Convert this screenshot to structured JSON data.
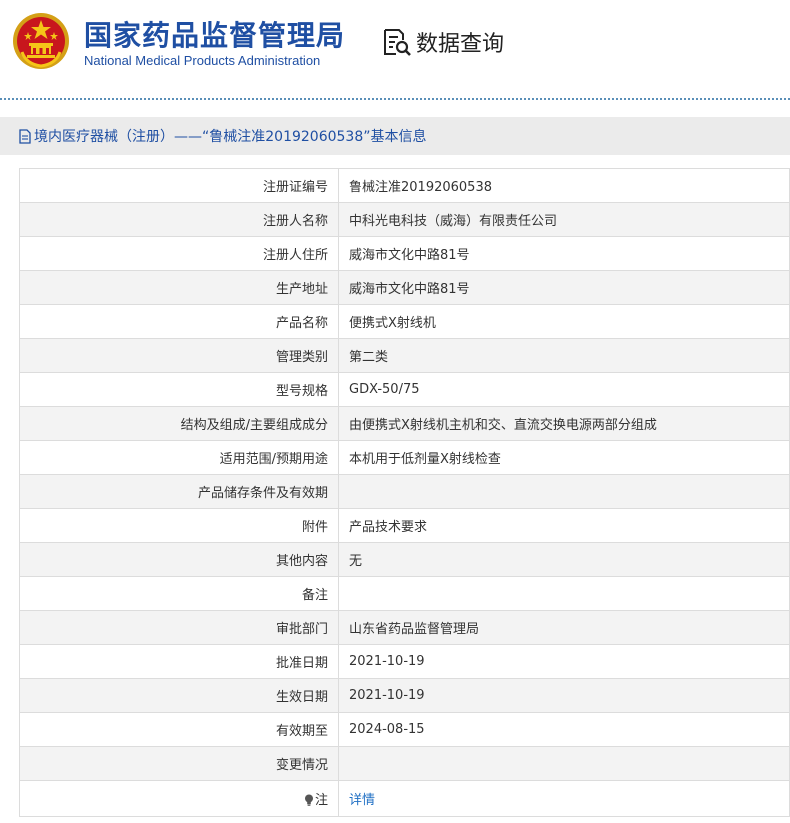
{
  "header": {
    "org_name_cn": "国家药品监督管理局",
    "org_name_en": "National Medical Products Administration",
    "query_label": "数据查询",
    "brand_color": "#1f4fa3"
  },
  "subtitle": {
    "text": "境内医疗器械（注册）——“鲁械注准20192060538”基本信息"
  },
  "rows": [
    {
      "label": "注册证编号",
      "value": "鲁械注准20192060538"
    },
    {
      "label": "注册人名称",
      "value": "中科光电科技（威海）有限责任公司"
    },
    {
      "label": "注册人住所",
      "value": "威海市文化中路81号"
    },
    {
      "label": "生产地址",
      "value": "威海市文化中路81号"
    },
    {
      "label": "产品名称",
      "value": "便携式X射线机"
    },
    {
      "label": "管理类别",
      "value": "第二类"
    },
    {
      "label": "型号规格",
      "value": "GDX-50/75"
    },
    {
      "label": "结构及组成/主要组成成分",
      "value": "由便携式X射线机主机和交、直流交换电源两部分组成"
    },
    {
      "label": "适用范围/预期用途",
      "value": "本机用于低剂量X射线检查"
    },
    {
      "label": "产品储存条件及有效期",
      "value": ""
    },
    {
      "label": "附件",
      "value": "产品技术要求"
    },
    {
      "label": "其他内容",
      "value": "无"
    },
    {
      "label": "备注",
      "value": ""
    },
    {
      "label": "审批部门",
      "value": "山东省药品监督管理局"
    },
    {
      "label": "批准日期",
      "value": "2021-10-19"
    },
    {
      "label": "生效日期",
      "value": "2021-10-19"
    },
    {
      "label": "有效期至",
      "value": "2024-08-15"
    },
    {
      "label": "变更情况",
      "value": ""
    }
  ],
  "note": {
    "label": "注",
    "link_text": "详情",
    "link_color": "#1f6fc4"
  }
}
